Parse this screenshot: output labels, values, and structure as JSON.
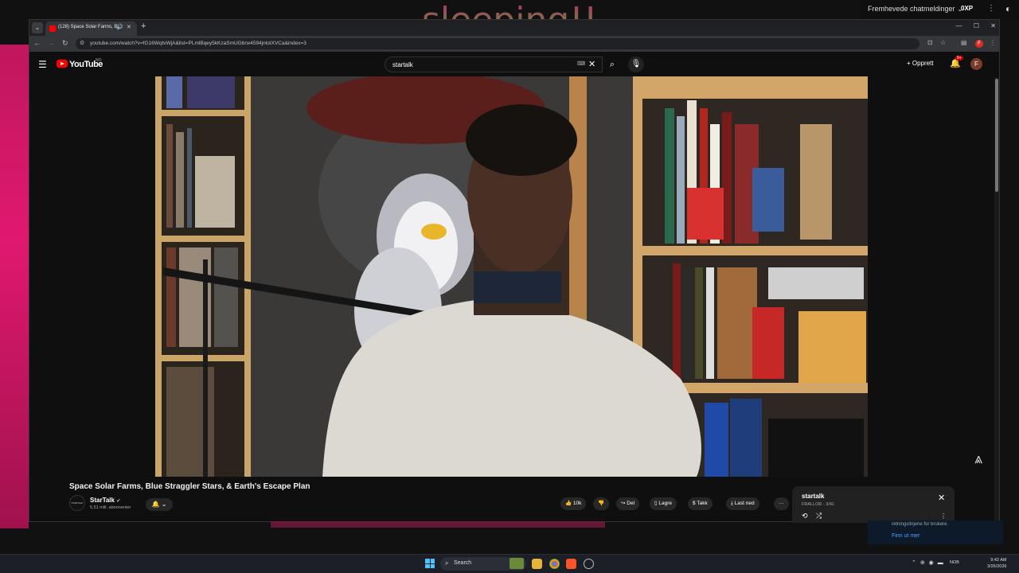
{
  "stream": {
    "overlay_text": "sleeping!!",
    "chat_title": "Fremhevede chatmeldinger",
    "xp_badge": "0XP",
    "chat_snippet_1": "retningslinjene for brukere.",
    "chat_snippet_2": "Finn ut mer"
  },
  "browser": {
    "tab_title": "(128) Space Solar Farms, Bl...",
    "url": "youtube.com/watch?v=fG16WqtvWjA&list=PLmlBqey5kKzaSmUGbnx4594jnlotXVCa&index=3",
    "window_controls": "— ☐ ✕"
  },
  "youtube": {
    "brand": "YouTube",
    "region": "NO",
    "search_query": "startalk",
    "create_label": "Opprett",
    "notif_count": "9+",
    "avatar_letter": "F",
    "video_title": "Space Solar Farms, Blue Straggler Stars, & Earth's Escape Plan",
    "channel_name": "StarTalk",
    "channel_subs": "5,51 mill. abonnenter",
    "channel_avatar_text": "STARTALK",
    "like_count": "10k",
    "actions": {
      "share": "Del",
      "save": "Lagre",
      "thanks": "Takk",
      "download": "Last ned"
    },
    "playlist": {
      "title": "startalk",
      "subtitle": "FRALLOR - 3/41"
    }
  },
  "taskbar": {
    "search_label": "Search",
    "lang": "NOB",
    "time": "9:42 AM",
    "date": "3/26/2026"
  },
  "colors": {
    "yt_red": "#ff0000",
    "pink_strip": "#e0186f"
  }
}
